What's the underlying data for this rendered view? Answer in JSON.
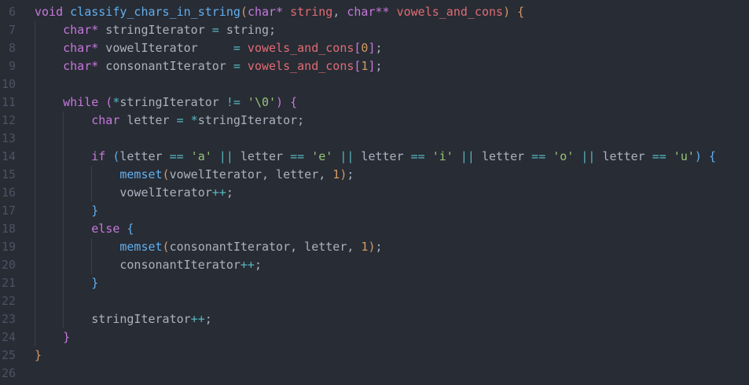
{
  "editor": {
    "lines": [
      {
        "number": "6",
        "indent": 0,
        "tokens": [
          {
            "t": "void",
            "c": "keyword"
          },
          {
            "t": " ",
            "c": "plain"
          },
          {
            "t": "classify_chars_in_string",
            "c": "function"
          },
          {
            "t": "(",
            "c": "bracket1"
          },
          {
            "t": "char",
            "c": "keyword"
          },
          {
            "t": "*",
            "c": "keyword"
          },
          {
            "t": " ",
            "c": "plain"
          },
          {
            "t": "string",
            "c": "param"
          },
          {
            "t": ", ",
            "c": "punct"
          },
          {
            "t": "char",
            "c": "keyword"
          },
          {
            "t": "**",
            "c": "keyword"
          },
          {
            "t": " ",
            "c": "plain"
          },
          {
            "t": "vowels_and_cons",
            "c": "param"
          },
          {
            "t": ")",
            "c": "bracket1"
          },
          {
            "t": " ",
            "c": "plain"
          },
          {
            "t": "{",
            "c": "bracket1"
          }
        ]
      },
      {
        "number": "7",
        "indent": 1,
        "tokens": [
          {
            "t": "char",
            "c": "keyword"
          },
          {
            "t": "*",
            "c": "keyword"
          },
          {
            "t": " ",
            "c": "plain"
          },
          {
            "t": "stringIterator",
            "c": "plain"
          },
          {
            "t": " ",
            "c": "plain"
          },
          {
            "t": "=",
            "c": "op"
          },
          {
            "t": " ",
            "c": "plain"
          },
          {
            "t": "string",
            "c": "plain"
          },
          {
            "t": ";",
            "c": "punct"
          }
        ]
      },
      {
        "number": "8",
        "indent": 1,
        "tokens": [
          {
            "t": "char",
            "c": "keyword"
          },
          {
            "t": "*",
            "c": "keyword"
          },
          {
            "t": " ",
            "c": "plain"
          },
          {
            "t": "vowelIterator",
            "c": "plain"
          },
          {
            "t": "     ",
            "c": "plain"
          },
          {
            "t": "=",
            "c": "op"
          },
          {
            "t": " ",
            "c": "plain"
          },
          {
            "t": "vowels_and_cons",
            "c": "param"
          },
          {
            "t": "[",
            "c": "bracket2"
          },
          {
            "t": "0",
            "c": "number"
          },
          {
            "t": "]",
            "c": "bracket2"
          },
          {
            "t": ";",
            "c": "punct"
          }
        ]
      },
      {
        "number": "9",
        "indent": 1,
        "tokens": [
          {
            "t": "char",
            "c": "keyword"
          },
          {
            "t": "*",
            "c": "keyword"
          },
          {
            "t": " ",
            "c": "plain"
          },
          {
            "t": "consonantIterator",
            "c": "plain"
          },
          {
            "t": " ",
            "c": "plain"
          },
          {
            "t": "=",
            "c": "op"
          },
          {
            "t": " ",
            "c": "plain"
          },
          {
            "t": "vowels_and_cons",
            "c": "param"
          },
          {
            "t": "[",
            "c": "bracket2"
          },
          {
            "t": "1",
            "c": "number"
          },
          {
            "t": "]",
            "c": "bracket2"
          },
          {
            "t": ";",
            "c": "punct"
          }
        ]
      },
      {
        "number": "10",
        "indent": 0,
        "tokens": []
      },
      {
        "number": "11",
        "indent": 1,
        "tokens": [
          {
            "t": "while",
            "c": "keyword"
          },
          {
            "t": " ",
            "c": "plain"
          },
          {
            "t": "(",
            "c": "bracket2"
          },
          {
            "t": "*",
            "c": "op"
          },
          {
            "t": "stringIterator",
            "c": "plain"
          },
          {
            "t": " ",
            "c": "plain"
          },
          {
            "t": "!=",
            "c": "op"
          },
          {
            "t": " ",
            "c": "plain"
          },
          {
            "t": "'\\0'",
            "c": "string"
          },
          {
            "t": ")",
            "c": "bracket2"
          },
          {
            "t": " ",
            "c": "plain"
          },
          {
            "t": "{",
            "c": "bracket2"
          }
        ]
      },
      {
        "number": "12",
        "indent": 2,
        "tokens": [
          {
            "t": "char",
            "c": "keyword"
          },
          {
            "t": " ",
            "c": "plain"
          },
          {
            "t": "letter",
            "c": "plain"
          },
          {
            "t": " ",
            "c": "plain"
          },
          {
            "t": "=",
            "c": "op"
          },
          {
            "t": " ",
            "c": "plain"
          },
          {
            "t": "*",
            "c": "op"
          },
          {
            "t": "stringIterator",
            "c": "plain"
          },
          {
            "t": ";",
            "c": "punct"
          }
        ]
      },
      {
        "number": "13",
        "indent": 0,
        "tokens": []
      },
      {
        "number": "14",
        "indent": 2,
        "tokens": [
          {
            "t": "if",
            "c": "keyword"
          },
          {
            "t": " ",
            "c": "plain"
          },
          {
            "t": "(",
            "c": "bracket3"
          },
          {
            "t": "letter",
            "c": "plain"
          },
          {
            "t": " ",
            "c": "plain"
          },
          {
            "t": "==",
            "c": "op"
          },
          {
            "t": " ",
            "c": "plain"
          },
          {
            "t": "'a'",
            "c": "string"
          },
          {
            "t": " ",
            "c": "plain"
          },
          {
            "t": "||",
            "c": "op"
          },
          {
            "t": " ",
            "c": "plain"
          },
          {
            "t": "letter",
            "c": "plain"
          },
          {
            "t": " ",
            "c": "plain"
          },
          {
            "t": "==",
            "c": "op"
          },
          {
            "t": " ",
            "c": "plain"
          },
          {
            "t": "'e'",
            "c": "string"
          },
          {
            "t": " ",
            "c": "plain"
          },
          {
            "t": "||",
            "c": "op"
          },
          {
            "t": " ",
            "c": "plain"
          },
          {
            "t": "letter",
            "c": "plain"
          },
          {
            "t": " ",
            "c": "plain"
          },
          {
            "t": "==",
            "c": "op"
          },
          {
            "t": " ",
            "c": "plain"
          },
          {
            "t": "'i'",
            "c": "string"
          },
          {
            "t": " ",
            "c": "plain"
          },
          {
            "t": "||",
            "c": "op"
          },
          {
            "t": " ",
            "c": "plain"
          },
          {
            "t": "letter",
            "c": "plain"
          },
          {
            "t": " ",
            "c": "plain"
          },
          {
            "t": "==",
            "c": "op"
          },
          {
            "t": " ",
            "c": "plain"
          },
          {
            "t": "'o'",
            "c": "string"
          },
          {
            "t": " ",
            "c": "plain"
          },
          {
            "t": "||",
            "c": "op"
          },
          {
            "t": " ",
            "c": "plain"
          },
          {
            "t": "letter",
            "c": "plain"
          },
          {
            "t": " ",
            "c": "plain"
          },
          {
            "t": "==",
            "c": "op"
          },
          {
            "t": " ",
            "c": "plain"
          },
          {
            "t": "'u'",
            "c": "string"
          },
          {
            "t": ")",
            "c": "bracket3"
          },
          {
            "t": " ",
            "c": "plain"
          },
          {
            "t": "{",
            "c": "bracket3"
          }
        ]
      },
      {
        "number": "15",
        "indent": 3,
        "tokens": [
          {
            "t": "memset",
            "c": "function"
          },
          {
            "t": "(",
            "c": "bracket1"
          },
          {
            "t": "vowelIterator",
            "c": "plain"
          },
          {
            "t": ", ",
            "c": "punct"
          },
          {
            "t": "letter",
            "c": "plain"
          },
          {
            "t": ", ",
            "c": "punct"
          },
          {
            "t": "1",
            "c": "number"
          },
          {
            "t": ")",
            "c": "bracket1"
          },
          {
            "t": ";",
            "c": "punct"
          }
        ]
      },
      {
        "number": "16",
        "indent": 3,
        "tokens": [
          {
            "t": "vowelIterator",
            "c": "plain"
          },
          {
            "t": "++",
            "c": "op"
          },
          {
            "t": ";",
            "c": "punct"
          }
        ]
      },
      {
        "number": "17",
        "indent": 2,
        "tokens": [
          {
            "t": "}",
            "c": "bracket3"
          }
        ]
      },
      {
        "number": "18",
        "indent": 2,
        "tokens": [
          {
            "t": "else",
            "c": "keyword"
          },
          {
            "t": " ",
            "c": "plain"
          },
          {
            "t": "{",
            "c": "bracket3"
          }
        ]
      },
      {
        "number": "19",
        "indent": 3,
        "tokens": [
          {
            "t": "memset",
            "c": "function"
          },
          {
            "t": "(",
            "c": "bracket1"
          },
          {
            "t": "consonantIterator",
            "c": "plain"
          },
          {
            "t": ", ",
            "c": "punct"
          },
          {
            "t": "letter",
            "c": "plain"
          },
          {
            "t": ", ",
            "c": "punct"
          },
          {
            "t": "1",
            "c": "number"
          },
          {
            "t": ")",
            "c": "bracket1"
          },
          {
            "t": ";",
            "c": "punct"
          }
        ]
      },
      {
        "number": "20",
        "indent": 3,
        "tokens": [
          {
            "t": "consonantIterator",
            "c": "plain"
          },
          {
            "t": "++",
            "c": "op"
          },
          {
            "t": ";",
            "c": "punct"
          }
        ]
      },
      {
        "number": "21",
        "indent": 2,
        "tokens": [
          {
            "t": "}",
            "c": "bracket3"
          }
        ]
      },
      {
        "number": "22",
        "indent": 0,
        "tokens": []
      },
      {
        "number": "23",
        "indent": 2,
        "tokens": [
          {
            "t": "stringIterator",
            "c": "plain"
          },
          {
            "t": "++",
            "c": "op"
          },
          {
            "t": ";",
            "c": "punct"
          }
        ]
      },
      {
        "number": "24",
        "indent": 1,
        "tokens": [
          {
            "t": "}",
            "c": "bracket2"
          }
        ]
      },
      {
        "number": "25",
        "indent": 0,
        "tokens": [
          {
            "t": "}",
            "c": "bracket1"
          }
        ]
      },
      {
        "number": "26",
        "indent": 0,
        "tokens": []
      }
    ],
    "colors": {
      "background": "#282c34",
      "keyword": "#c678dd",
      "function": "#61afef",
      "param": "#e06c75",
      "string": "#98c379",
      "number": "#d19a66",
      "operator": "#56b6c2",
      "plain": "#abb2bf",
      "line_number": "#4b5263"
    }
  }
}
